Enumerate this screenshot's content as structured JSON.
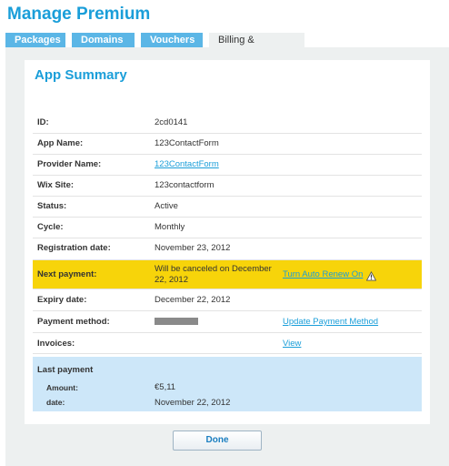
{
  "header": {
    "title": "Manage Premium"
  },
  "tabs": [
    {
      "label": "Packages"
    },
    {
      "label": "Domains"
    },
    {
      "label": "Vouchers"
    },
    {
      "label": "Billing & Payment",
      "active": true
    }
  ],
  "summary": {
    "title": "App Summary",
    "rows": {
      "id": {
        "label": "ID:",
        "value": "2cd0141"
      },
      "app_name": {
        "label": "App Name:",
        "value": "123ContactForm"
      },
      "provider_name": {
        "label": "Provider Name:",
        "value": "123ContactForm"
      },
      "wix_site": {
        "label": "Wix Site:",
        "value": "123contactform"
      },
      "status": {
        "label": "Status:",
        "value": "Active"
      },
      "cycle": {
        "label": "Cycle:",
        "value": "Monthly"
      },
      "registration_date": {
        "label": "Registration date:",
        "value": "November 23, 2012"
      },
      "next_payment": {
        "label": "Next payment:",
        "value_line1": "Will be canceled on December",
        "value_line2": "22, 2012",
        "action": "Turn Auto Renew On"
      },
      "expiry_date": {
        "label": "Expiry date:",
        "value": "December 22, 2012"
      },
      "payment_method": {
        "label": "Payment method:",
        "action": "Update Payment Method"
      },
      "invoices": {
        "label": "Invoices:",
        "action": "View"
      }
    },
    "last_payment": {
      "title": "Last payment",
      "amount_label": "Amount:",
      "amount_value": "€5,11",
      "date_label": "date:",
      "date_value": "November 22, 2012"
    }
  },
  "footer": {
    "done_label": "Done"
  },
  "colors": {
    "accent": "#1a9ed9",
    "highlight": "#f7d40a",
    "summary_bg": "#cde7f9"
  },
  "icons": {
    "warning": "warning-icon"
  }
}
